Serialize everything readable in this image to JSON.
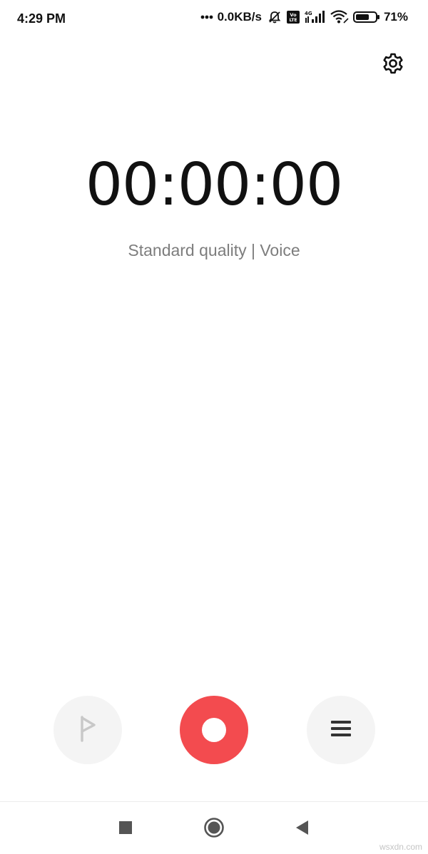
{
  "status_bar": {
    "time": "4:29 PM",
    "net_speed": "0.0KB/s",
    "volte_label": "Vo LTE",
    "network_label": "4G",
    "battery_level": 0.71,
    "battery": "71%",
    "icons": [
      "more-dots-icon",
      "mute-bell-icon",
      "volte-icon",
      "signal-icon",
      "wifi-icon",
      "battery-icon"
    ]
  },
  "header": {
    "settings_icon": "gear-icon"
  },
  "recorder": {
    "timer": "00:00:00",
    "quality_label": "Standard quality | Voice"
  },
  "controls": {
    "flag_icon": "flag-icon",
    "record_icon": "record-icon",
    "record_color": "#f34b4f",
    "list_icon": "menu-icon"
  },
  "navigation": {
    "icons": [
      "square-icon",
      "circle-icon",
      "back-triangle-icon"
    ]
  },
  "watermark": "wsxdn.com"
}
